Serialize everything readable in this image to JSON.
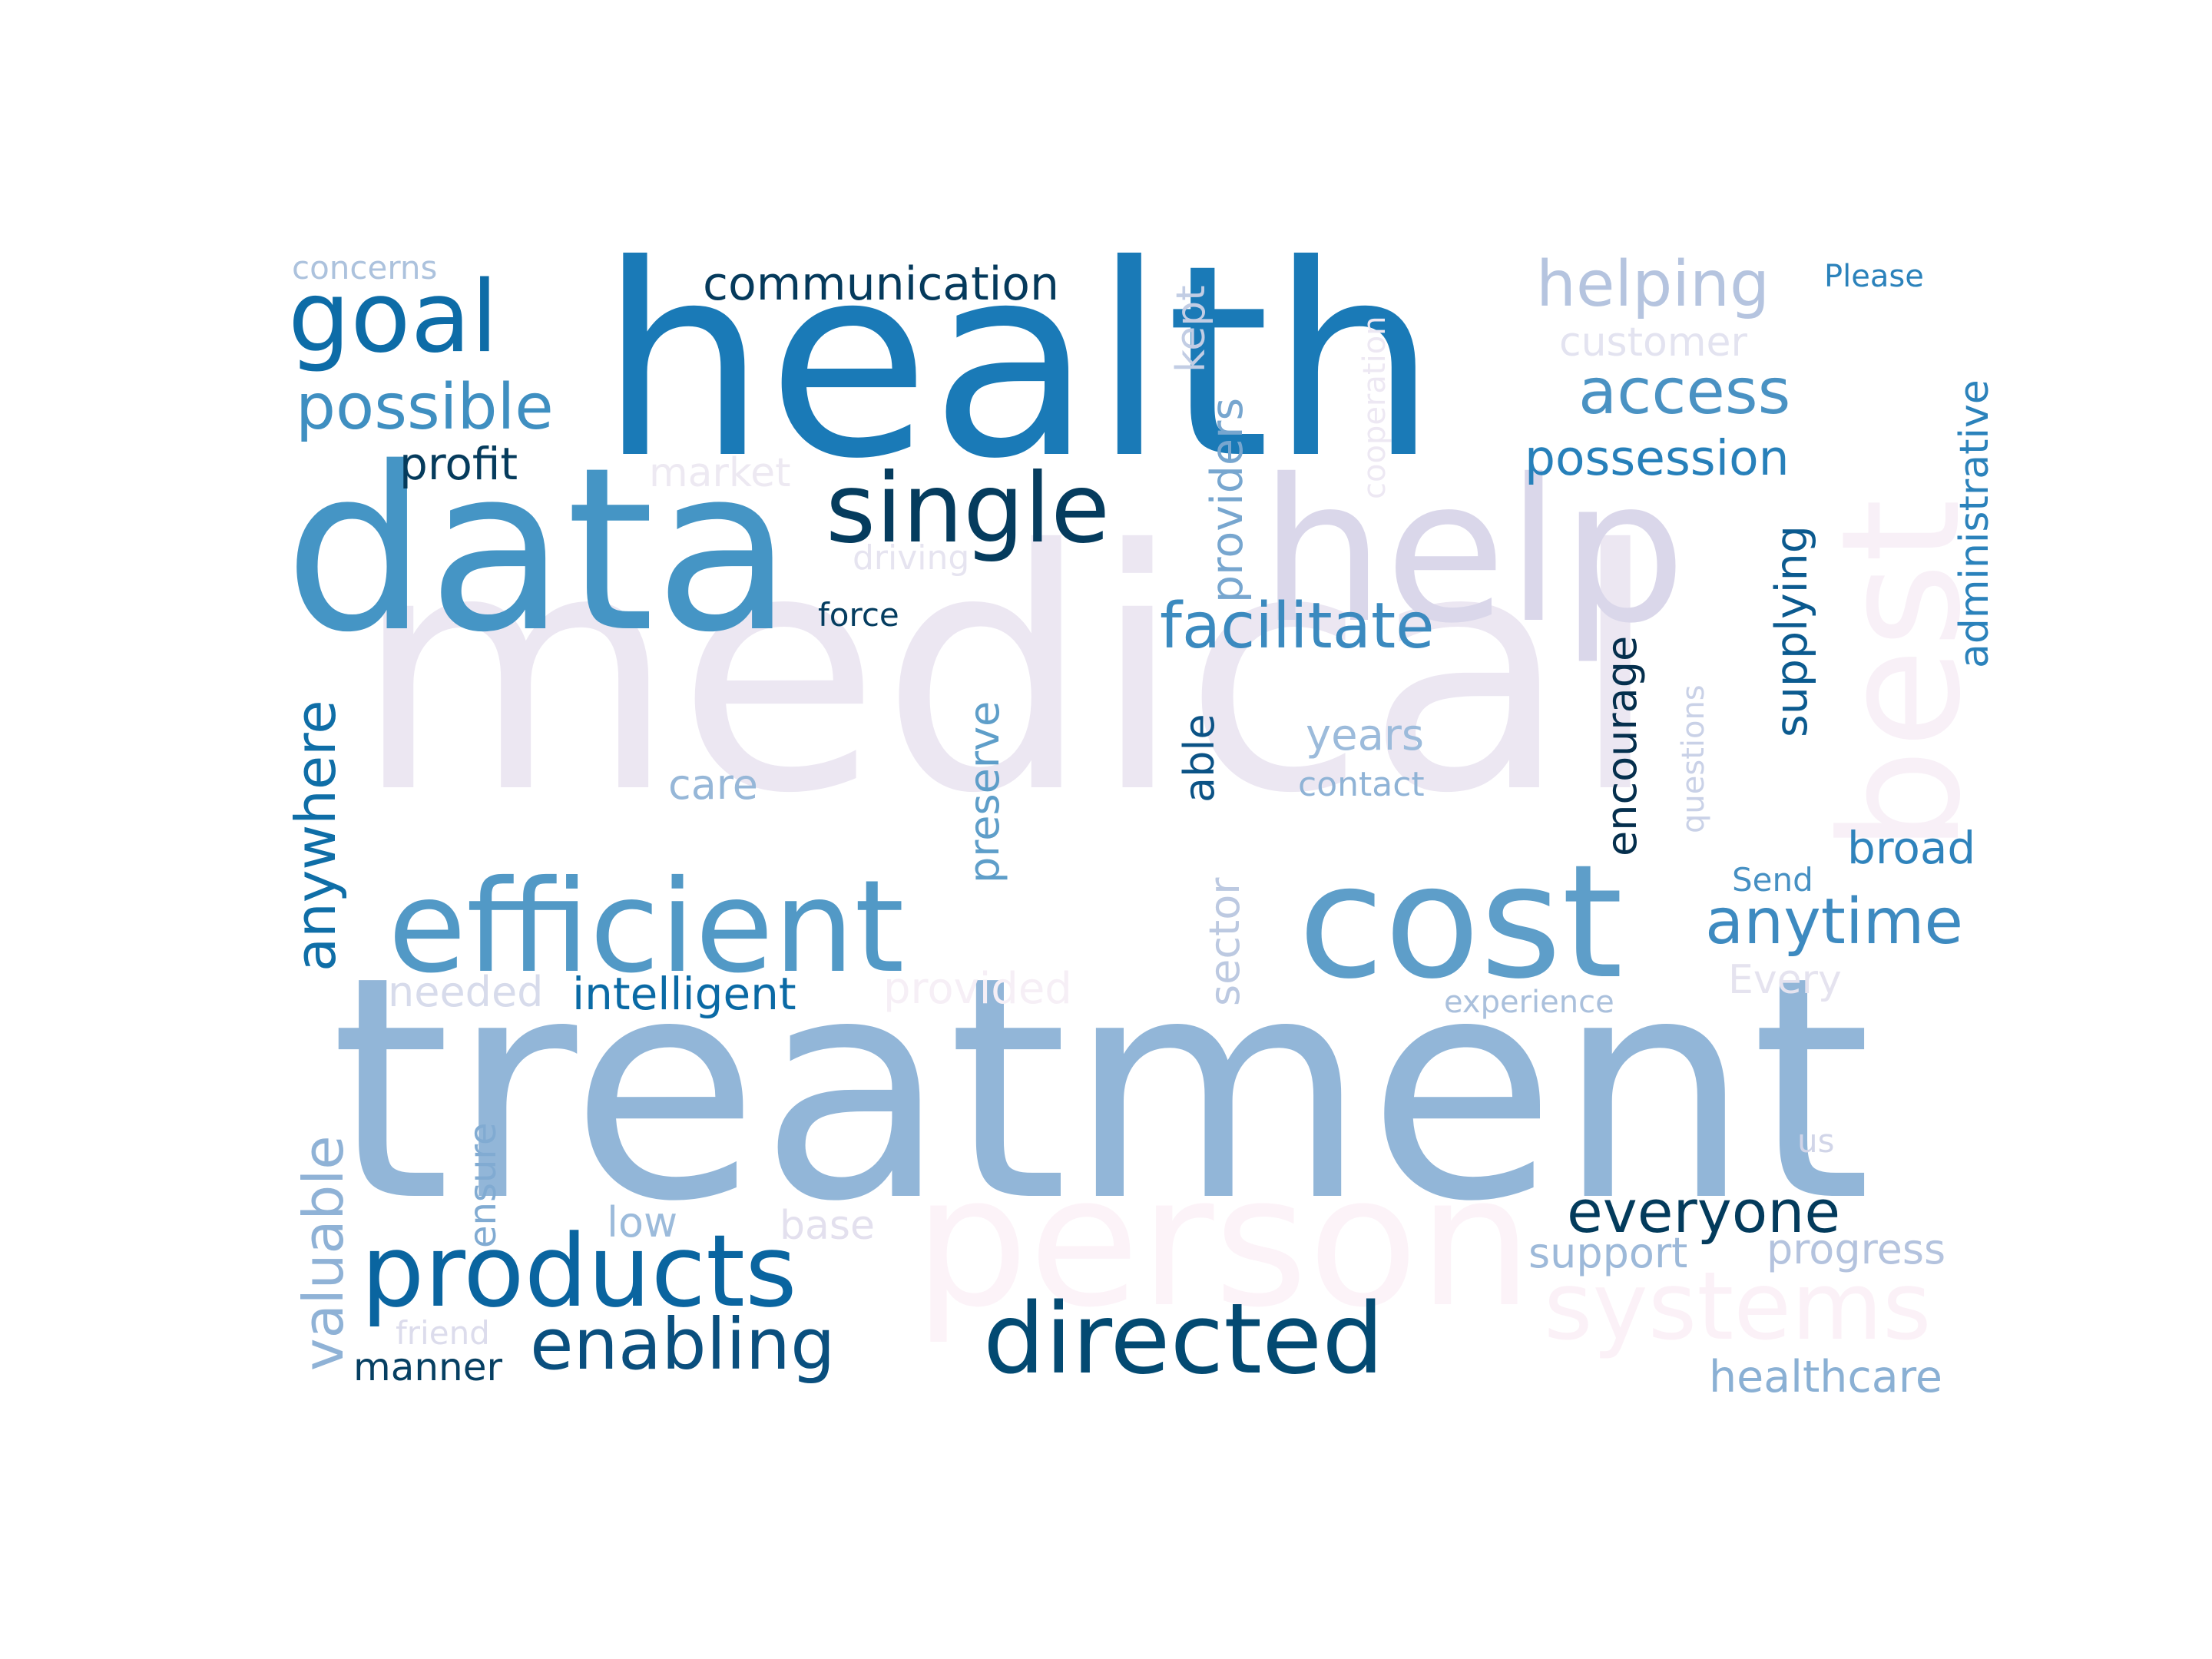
{
  "words": [
    {
      "text": "medical",
      "color": "#ece7f2"
    },
    {
      "text": "treatment",
      "color": "#92b6d8"
    },
    {
      "text": "health",
      "color": "#1a7ab7"
    },
    {
      "text": "data",
      "color": "#4595c5"
    },
    {
      "text": "help",
      "color": "#dad7ea"
    },
    {
      "text": "person",
      "color": "#fcf3f8"
    },
    {
      "text": "best",
      "color": "#f8f0f7"
    },
    {
      "text": "cost",
      "color": "#5e9ec9"
    },
    {
      "text": "efficient",
      "color": "#5299c6"
    },
    {
      "text": "single",
      "color": "#053c5e"
    },
    {
      "text": "goal",
      "color": "#0d6ca7"
    },
    {
      "text": "products",
      "color": "#0a65a0"
    },
    {
      "text": "directed",
      "color": "#034a72"
    },
    {
      "text": "systems",
      "color": "#fbf1f7"
    },
    {
      "text": "possible",
      "color": "#3f8fc1"
    },
    {
      "text": "facilitate",
      "color": "#3b8abf"
    },
    {
      "text": "access",
      "color": "#4a92c3"
    },
    {
      "text": "helping",
      "color": "#b5c4df"
    },
    {
      "text": "enabling",
      "color": "#0a4f7e"
    },
    {
      "text": "anytime",
      "color": "#3d8ac0"
    },
    {
      "text": "everyone",
      "color": "#033b5c"
    },
    {
      "text": "communication",
      "color": "#053a5c"
    },
    {
      "text": "possession",
      "color": "#2780ba"
    },
    {
      "text": "anywhere",
      "color": "#0f6ea7"
    },
    {
      "text": "valuable",
      "color": "#8fb2d6"
    },
    {
      "text": "intelligent",
      "color": "#0a6aa5"
    },
    {
      "text": "administrative",
      "color": "#2b82bb"
    },
    {
      "text": "supplying",
      "color": "#0b5a8f"
    },
    {
      "text": "encourage",
      "color": "#052f4d"
    },
    {
      "text": "providers",
      "color": "#77a6cf"
    },
    {
      "text": "healthcare",
      "color": "#8ab0d4"
    },
    {
      "text": "profit",
      "color": "#053b5c"
    },
    {
      "text": "broad",
      "color": "#2f83bc"
    },
    {
      "text": "years",
      "color": "#9cbbdb"
    },
    {
      "text": "preserve",
      "color": "#5e9ec9"
    },
    {
      "text": "care",
      "color": "#96b7d8"
    },
    {
      "text": "able",
      "color": "#0b5386"
    },
    {
      "text": "manner",
      "color": "#063f62"
    },
    {
      "text": "support",
      "color": "#9db9d9"
    },
    {
      "text": "progress",
      "color": "#b4c3de"
    },
    {
      "text": "sector",
      "color": "#bcc9e1"
    },
    {
      "text": "customer",
      "color": "#e3e3f0"
    },
    {
      "text": "kept",
      "color": "#c2cde4"
    },
    {
      "text": "cooperation",
      "color": "#ede8f3"
    },
    {
      "text": "questions",
      "color": "#c9d1e7"
    },
    {
      "text": "ensure",
      "color": "#81abd2"
    },
    {
      "text": "low",
      "color": "#9cbbdb"
    },
    {
      "text": "base",
      "color": "#e3e0ee"
    },
    {
      "text": "needed",
      "color": "#d7dbeb"
    },
    {
      "text": "provided",
      "color": "#f6eff6"
    },
    {
      "text": "Every",
      "color": "#e5e3ef"
    },
    {
      "text": "market",
      "color": "#ede9f2"
    },
    {
      "text": "contact",
      "color": "#8fb3d6"
    },
    {
      "text": "Send",
      "color": "#4690c3"
    },
    {
      "text": "experience",
      "color": "#aac0dc"
    },
    {
      "text": "Please",
      "color": "#2b82bb"
    },
    {
      "text": "concerns",
      "color": "#acc2dd"
    },
    {
      "text": "force",
      "color": "#053d60"
    },
    {
      "text": "driving",
      "color": "#e6e4f0"
    },
    {
      "text": "friend",
      "color": "#dcdcec"
    },
    {
      "text": "us",
      "color": "#d1d5e8"
    }
  ]
}
